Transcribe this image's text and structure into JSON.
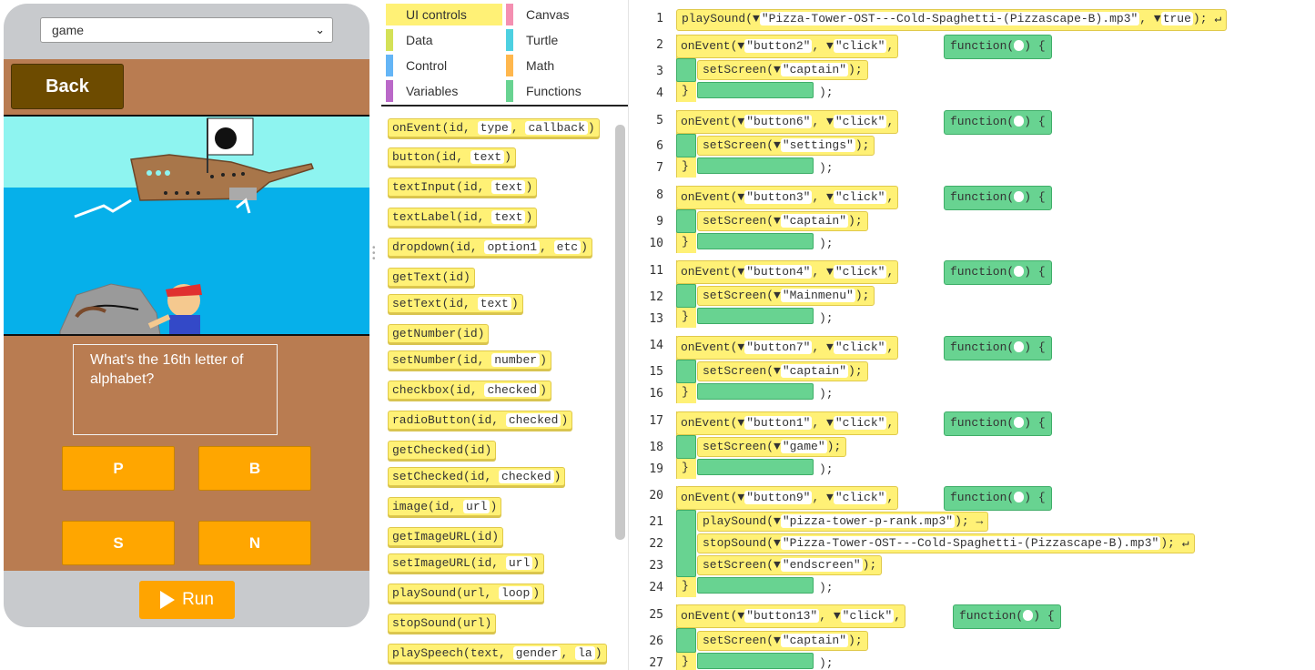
{
  "preview": {
    "screen_selected": "game",
    "back_label": "Back",
    "question": "What's the 16th letter of alphabet?",
    "answers": [
      "P",
      "B",
      "S",
      "N"
    ],
    "run_label": "Run"
  },
  "toolbox": {
    "categories": [
      {
        "label": "UI controls",
        "color": "#fff176"
      },
      {
        "label": "Canvas",
        "color": "#f48fb1"
      },
      {
        "label": "Data",
        "color": "#d4e157"
      },
      {
        "label": "Turtle",
        "color": "#4dd0e1"
      },
      {
        "label": "Control",
        "color": "#64b5f6"
      },
      {
        "label": "Math",
        "color": "#ffb74d"
      },
      {
        "label": "Variables",
        "color": "#ba68c8"
      },
      {
        "label": "Functions",
        "color": "#68d391"
      }
    ],
    "blocks": [
      {
        "name": "onEvent",
        "params": [
          "id",
          "type",
          "callback"
        ]
      },
      {
        "name": "button",
        "params": [
          "id",
          "text"
        ]
      },
      {
        "name": "textInput",
        "params": [
          "id",
          "text"
        ]
      },
      {
        "name": "textLabel",
        "params": [
          "id",
          "text"
        ]
      },
      {
        "name": "dropdown",
        "params": [
          "id",
          "option1",
          "etc"
        ]
      },
      {
        "name": "getText",
        "params": [
          "id"
        ]
      },
      {
        "name": "setText",
        "params": [
          "id",
          "text"
        ]
      },
      {
        "name": "getNumber",
        "params": [
          "id"
        ]
      },
      {
        "name": "setNumber",
        "params": [
          "id",
          "number"
        ]
      },
      {
        "name": "checkbox",
        "params": [
          "id",
          "checked"
        ]
      },
      {
        "name": "radioButton",
        "params": [
          "id",
          "checked"
        ]
      },
      {
        "name": "getChecked",
        "params": [
          "id"
        ]
      },
      {
        "name": "setChecked",
        "params": [
          "id",
          "checked"
        ]
      },
      {
        "name": "image",
        "params": [
          "id",
          "url"
        ]
      },
      {
        "name": "getImageURL",
        "params": [
          "id"
        ]
      },
      {
        "name": "setImageURL",
        "params": [
          "id",
          "url"
        ]
      },
      {
        "name": "playSound",
        "params": [
          "url",
          "loop"
        ]
      },
      {
        "name": "stopSound",
        "params": [
          "url"
        ]
      },
      {
        "name": "playSpeech",
        "params": [
          "text",
          "gender",
          "la"
        ]
      }
    ]
  },
  "code": {
    "line1": {
      "fn": "playSound",
      "arg": "\"Pizza-Tower-OST---Cold-Spaghetti-(Pizzascape-B).mp3\"",
      "arg2": "true"
    },
    "events": [
      {
        "start": 2,
        "id": "\"button2\"",
        "type": "\"click\"",
        "body": [
          {
            "fn": "setScreen",
            "arg": "\"captain\""
          }
        ]
      },
      {
        "start": 5,
        "id": "\"button6\"",
        "type": "\"click\"",
        "body": [
          {
            "fn": "setScreen",
            "arg": "\"settings\""
          }
        ]
      },
      {
        "start": 8,
        "id": "\"button3\"",
        "type": "\"click\"",
        "body": [
          {
            "fn": "setScreen",
            "arg": "\"captain\""
          }
        ]
      },
      {
        "start": 11,
        "id": "\"button4\"",
        "type": "\"click\"",
        "body": [
          {
            "fn": "setScreen",
            "arg": "\"Mainmenu\""
          }
        ]
      },
      {
        "start": 14,
        "id": "\"button7\"",
        "type": "\"click\"",
        "body": [
          {
            "fn": "setScreen",
            "arg": "\"captain\""
          }
        ]
      },
      {
        "start": 17,
        "id": "\"button1\"",
        "type": "\"click\"",
        "body": [
          {
            "fn": "setScreen",
            "arg": "\"game\""
          }
        ]
      },
      {
        "start": 20,
        "id": "\"button9\"",
        "type": "\"click\"",
        "body": [
          {
            "fn": "playSound",
            "arg": "\"pizza-tower-p-rank.mp3\""
          },
          {
            "fn": "stopSound",
            "arg": "\"Pizza-Tower-OST---Cold-Spaghetti-(Pizzascape-B).mp3\""
          },
          {
            "fn": "setScreen",
            "arg": "\"endscreen\""
          }
        ]
      },
      {
        "start": 25,
        "id": "\"button13\"",
        "type": "\"click\"",
        "body": [
          {
            "fn": "setScreen",
            "arg": "\"captain\""
          }
        ]
      }
    ],
    "keywords": {
      "onEvent": "onEvent",
      "function": "function"
    }
  }
}
